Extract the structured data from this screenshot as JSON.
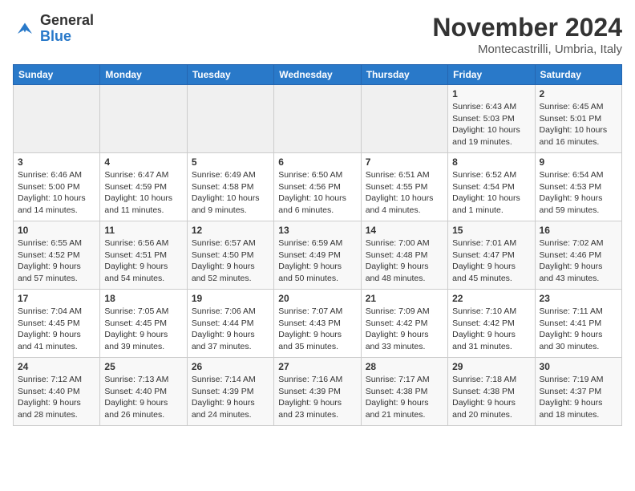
{
  "header": {
    "logo_line1": "General",
    "logo_line2": "Blue",
    "month": "November 2024",
    "location": "Montecastrilli, Umbria, Italy"
  },
  "weekdays": [
    "Sunday",
    "Monday",
    "Tuesday",
    "Wednesday",
    "Thursday",
    "Friday",
    "Saturday"
  ],
  "weeks": [
    [
      {
        "day": "",
        "info": ""
      },
      {
        "day": "",
        "info": ""
      },
      {
        "day": "",
        "info": ""
      },
      {
        "day": "",
        "info": ""
      },
      {
        "day": "",
        "info": ""
      },
      {
        "day": "1",
        "info": "Sunrise: 6:43 AM\nSunset: 5:03 PM\nDaylight: 10 hours and 19 minutes."
      },
      {
        "day": "2",
        "info": "Sunrise: 6:45 AM\nSunset: 5:01 PM\nDaylight: 10 hours and 16 minutes."
      }
    ],
    [
      {
        "day": "3",
        "info": "Sunrise: 6:46 AM\nSunset: 5:00 PM\nDaylight: 10 hours and 14 minutes."
      },
      {
        "day": "4",
        "info": "Sunrise: 6:47 AM\nSunset: 4:59 PM\nDaylight: 10 hours and 11 minutes."
      },
      {
        "day": "5",
        "info": "Sunrise: 6:49 AM\nSunset: 4:58 PM\nDaylight: 10 hours and 9 minutes."
      },
      {
        "day": "6",
        "info": "Sunrise: 6:50 AM\nSunset: 4:56 PM\nDaylight: 10 hours and 6 minutes."
      },
      {
        "day": "7",
        "info": "Sunrise: 6:51 AM\nSunset: 4:55 PM\nDaylight: 10 hours and 4 minutes."
      },
      {
        "day": "8",
        "info": "Sunrise: 6:52 AM\nSunset: 4:54 PM\nDaylight: 10 hours and 1 minute."
      },
      {
        "day": "9",
        "info": "Sunrise: 6:54 AM\nSunset: 4:53 PM\nDaylight: 9 hours and 59 minutes."
      }
    ],
    [
      {
        "day": "10",
        "info": "Sunrise: 6:55 AM\nSunset: 4:52 PM\nDaylight: 9 hours and 57 minutes."
      },
      {
        "day": "11",
        "info": "Sunrise: 6:56 AM\nSunset: 4:51 PM\nDaylight: 9 hours and 54 minutes."
      },
      {
        "day": "12",
        "info": "Sunrise: 6:57 AM\nSunset: 4:50 PM\nDaylight: 9 hours and 52 minutes."
      },
      {
        "day": "13",
        "info": "Sunrise: 6:59 AM\nSunset: 4:49 PM\nDaylight: 9 hours and 50 minutes."
      },
      {
        "day": "14",
        "info": "Sunrise: 7:00 AM\nSunset: 4:48 PM\nDaylight: 9 hours and 48 minutes."
      },
      {
        "day": "15",
        "info": "Sunrise: 7:01 AM\nSunset: 4:47 PM\nDaylight: 9 hours and 45 minutes."
      },
      {
        "day": "16",
        "info": "Sunrise: 7:02 AM\nSunset: 4:46 PM\nDaylight: 9 hours and 43 minutes."
      }
    ],
    [
      {
        "day": "17",
        "info": "Sunrise: 7:04 AM\nSunset: 4:45 PM\nDaylight: 9 hours and 41 minutes."
      },
      {
        "day": "18",
        "info": "Sunrise: 7:05 AM\nSunset: 4:45 PM\nDaylight: 9 hours and 39 minutes."
      },
      {
        "day": "19",
        "info": "Sunrise: 7:06 AM\nSunset: 4:44 PM\nDaylight: 9 hours and 37 minutes."
      },
      {
        "day": "20",
        "info": "Sunrise: 7:07 AM\nSunset: 4:43 PM\nDaylight: 9 hours and 35 minutes."
      },
      {
        "day": "21",
        "info": "Sunrise: 7:09 AM\nSunset: 4:42 PM\nDaylight: 9 hours and 33 minutes."
      },
      {
        "day": "22",
        "info": "Sunrise: 7:10 AM\nSunset: 4:42 PM\nDaylight: 9 hours and 31 minutes."
      },
      {
        "day": "23",
        "info": "Sunrise: 7:11 AM\nSunset: 4:41 PM\nDaylight: 9 hours and 30 minutes."
      }
    ],
    [
      {
        "day": "24",
        "info": "Sunrise: 7:12 AM\nSunset: 4:40 PM\nDaylight: 9 hours and 28 minutes."
      },
      {
        "day": "25",
        "info": "Sunrise: 7:13 AM\nSunset: 4:40 PM\nDaylight: 9 hours and 26 minutes."
      },
      {
        "day": "26",
        "info": "Sunrise: 7:14 AM\nSunset: 4:39 PM\nDaylight: 9 hours and 24 minutes."
      },
      {
        "day": "27",
        "info": "Sunrise: 7:16 AM\nSunset: 4:39 PM\nDaylight: 9 hours and 23 minutes."
      },
      {
        "day": "28",
        "info": "Sunrise: 7:17 AM\nSunset: 4:38 PM\nDaylight: 9 hours and 21 minutes."
      },
      {
        "day": "29",
        "info": "Sunrise: 7:18 AM\nSunset: 4:38 PM\nDaylight: 9 hours and 20 minutes."
      },
      {
        "day": "30",
        "info": "Sunrise: 7:19 AM\nSunset: 4:37 PM\nDaylight: 9 hours and 18 minutes."
      }
    ]
  ]
}
